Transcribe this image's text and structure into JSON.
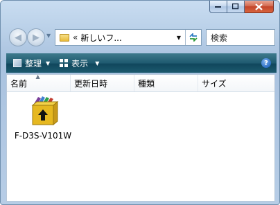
{
  "window": {
    "caption_buttons": [
      "minimize",
      "maximize",
      "close"
    ]
  },
  "nav": {
    "address_chevron": "«",
    "address_text": "新しいフ...",
    "search_placeholder": "検索"
  },
  "toolbar": {
    "organize_label": "整理",
    "views_label": "表示",
    "help_symbol": "?"
  },
  "columns": {
    "name": "名前",
    "date_modified": "更新日時",
    "type": "種類",
    "size": "サイズ"
  },
  "files": [
    {
      "name": "F-D3S-V101W",
      "icon": "archive-install-icon"
    }
  ],
  "colors": {
    "toolbar_accent": "#1f5a70",
    "close_button": "#c3442a",
    "window_frame": "#b6cde6"
  }
}
